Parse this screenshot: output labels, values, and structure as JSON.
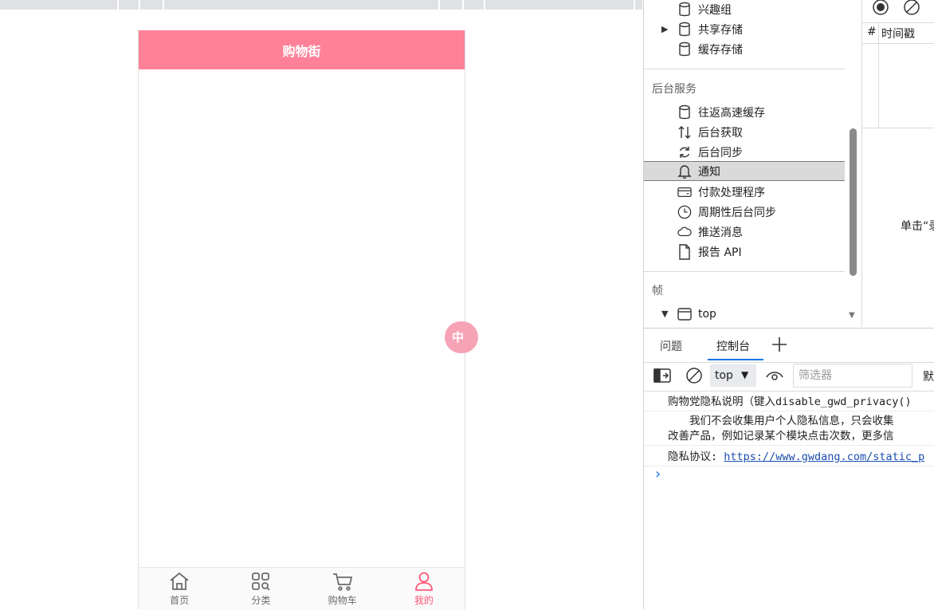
{
  "phone": {
    "header_title": "购物街",
    "float_button_text": "中",
    "tabbar": [
      {
        "label": "首页",
        "icon": "home-icon",
        "active": false
      },
      {
        "label": "分类",
        "icon": "category-grid-icon",
        "active": false
      },
      {
        "label": "购物车",
        "icon": "cart-icon",
        "active": false
      },
      {
        "label": "我的",
        "icon": "user-icon",
        "active": true
      }
    ],
    "accent": "#ff8198",
    "active_color": "#ff5777"
  },
  "devtools": {
    "storage": {
      "items": [
        {
          "label": "兴趣组",
          "icon": "database-icon"
        },
        {
          "label": "共享存储",
          "icon": "database-icon",
          "expandable": true
        },
        {
          "label": "缓存存储",
          "icon": "database-icon"
        }
      ]
    },
    "background_services": {
      "title": "后台服务",
      "items": [
        {
          "label": "往返高速缓存",
          "icon": "database-icon"
        },
        {
          "label": "后台获取",
          "icon": "arrows-up-down-icon"
        },
        {
          "label": "后台同步",
          "icon": "sync-icon"
        },
        {
          "label": "通知",
          "icon": "bell-icon",
          "selected": true
        },
        {
          "label": "付款处理程序",
          "icon": "card-icon"
        },
        {
          "label": "周期性后台同步",
          "icon": "clock-icon"
        },
        {
          "label": "推送消息",
          "icon": "cloud-icon"
        },
        {
          "label": "报告 API",
          "icon": "file-icon"
        }
      ]
    },
    "frames": {
      "title": "帧",
      "items": [
        {
          "label": "top",
          "icon": "window-icon"
        }
      ]
    },
    "right_pane": {
      "col_hash": "#",
      "col_timestamp": "时间戳",
      "hint": "单击“录"
    },
    "drawer": {
      "tabs": [
        "问题",
        "控制台"
      ],
      "active_tab": "控制台",
      "context": "top",
      "filter_placeholder": "筛选器",
      "levels_label": "默"
    },
    "console": {
      "line1": "购物党隐私说明（键入disable_gwd_privacy()",
      "line2a": "　　我们不会收集用户个人隐私信息，只会收集",
      "line2b": "改善产品，例如记录某个模块点击次数，更多信",
      "line3_prefix": "隐私协议: ",
      "line3_link": "https://www.gwdang.com/static_p",
      "prompt": "›"
    }
  }
}
